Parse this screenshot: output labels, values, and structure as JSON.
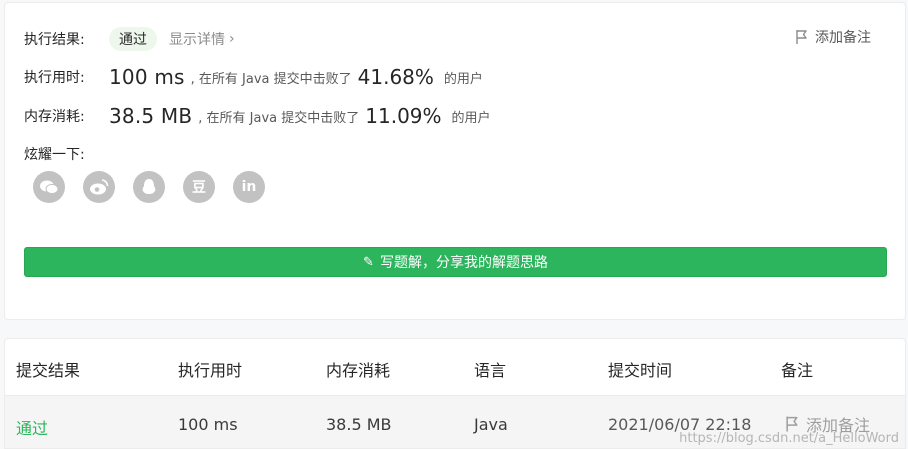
{
  "result": {
    "label": "执行结果:",
    "status": "通过",
    "detail_link": "显示详情",
    "add_note": "添加备注"
  },
  "runtime": {
    "label": "执行用时:",
    "value": "100 ms",
    "text_before": ", 在所有 Java 提交中击败了",
    "percent": "41.68%",
    "text_after": "的用户"
  },
  "memory": {
    "label": "内存消耗:",
    "value": "38.5 MB",
    "text_before": ", 在所有 Java 提交中击败了",
    "percent": "11.09%",
    "text_after": "的用户"
  },
  "share": {
    "label": "炫耀一下:",
    "icons": [
      "wechat-icon",
      "weibo-icon",
      "qq-icon",
      "douban-icon",
      "linkedin-icon"
    ],
    "douban_glyph": "豆",
    "linkedin_glyph": "in"
  },
  "write_solution": {
    "label": "写题解，分享我的解题思路"
  },
  "table": {
    "headers": [
      "提交结果",
      "执行用时",
      "内存消耗",
      "语言",
      "提交时间",
      "备注"
    ],
    "row": {
      "status": "通过",
      "runtime": "100 ms",
      "memory": "38.5 MB",
      "language": "Java",
      "time": "2021/06/07 22:18",
      "note": "添加备注"
    }
  },
  "watermark": "https://blog.csdn.net/a_HelloWord",
  "colors": {
    "accent": "#2db55d",
    "icon_bg": "#c2c2c2"
  }
}
